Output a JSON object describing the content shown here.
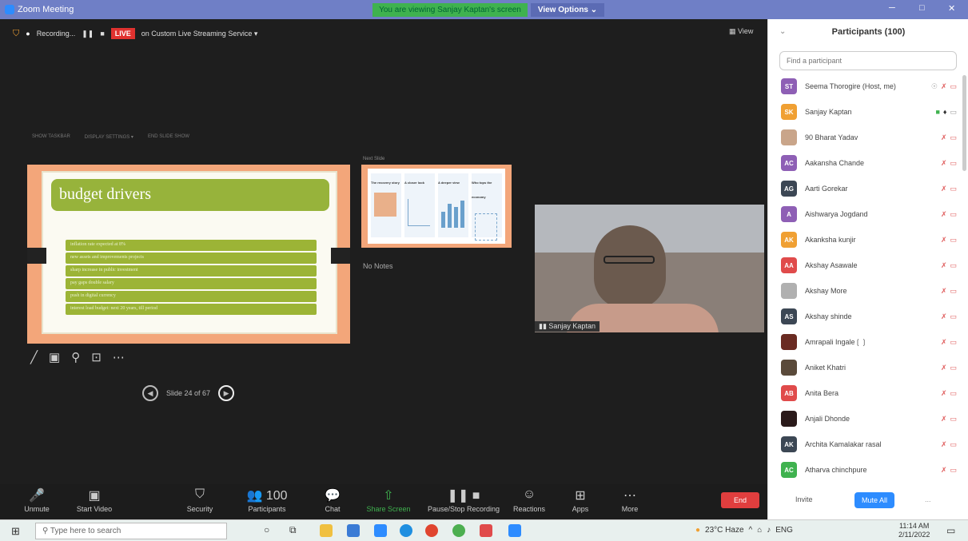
{
  "window": {
    "title": "Zoom Meeting",
    "viewing_banner": "You are viewing Sanjay Kaptan's screen",
    "view_options": "View Options ⌄",
    "minimize": "─",
    "maximize": "□",
    "close": "✕"
  },
  "recording": {
    "status": "Recording...",
    "pause": "❚❚",
    "stop": "■",
    "live_badge": "LIVE",
    "streaming_text": "on Custom Live Streaming Service ▾"
  },
  "view_button": "View",
  "presenter_toolbar": [
    "SHOW TASKBAR",
    "DISPLAY SETTINGS ▾",
    "END SLIDE SHOW"
  ],
  "slide": {
    "title": "budget drivers",
    "bullets": [
      "inflation rate expected at 8%",
      "new assets and improvements projects",
      "sharp increase in   public investment",
      "pay gaps double salary",
      "push in digital currency",
      "interest load budget: next 20 years, till period"
    ],
    "next_label": "Next Slide",
    "no_notes": "No Notes",
    "counter": "Slide 24 of 67"
  },
  "next_slide_cols": [
    "The recovery story",
    "A closer look",
    "A deeper view",
    "Who tops the economy"
  ],
  "video": {
    "name": "Sanjay Kaptan"
  },
  "annotation_tools": [
    "╱",
    "▣",
    "⚲",
    "⊡",
    "⋯"
  ],
  "toolbar": {
    "items": [
      {
        "icon": "🎤",
        "label": "Unmute"
      },
      {
        "icon": "▣",
        "label": "Start Video"
      },
      {
        "icon": "⛉",
        "label": "Security"
      },
      {
        "icon": "👥 100",
        "label": "Participants"
      },
      {
        "icon": "💬",
        "label": "Chat"
      },
      {
        "icon": "⇧",
        "label": "Share Screen"
      },
      {
        "icon": "❚❚ ■",
        "label": "Pause/Stop Recording"
      },
      {
        "icon": "☺",
        "label": "Reactions"
      },
      {
        "icon": "⊞",
        "label": "Apps"
      },
      {
        "icon": "⋯",
        "label": "More"
      }
    ],
    "end": "End"
  },
  "participants": {
    "title": "Participants (100)",
    "search_placeholder": "Find a participant",
    "list": [
      {
        "initials": "ST",
        "name": "Seema Thorogire (Host, me)",
        "color": "#8e5fb5"
      },
      {
        "initials": "SK",
        "name": "Sanjay Kaptan",
        "color": "#f0a033"
      },
      {
        "initials": "",
        "name": "90 Bharat Yadav",
        "color": "#c9a58a"
      },
      {
        "initials": "AC",
        "name": "Aakansha Chande",
        "color": "#8e5fb5"
      },
      {
        "initials": "AG",
        "name": "Aarti Gorekar",
        "color": "#3c4754"
      },
      {
        "initials": "A",
        "name": "Aishwarya Jogdand",
        "color": "#8e5fb5"
      },
      {
        "initials": "AK",
        "name": "Akanksha kunjir",
        "color": "#f0a033"
      },
      {
        "initials": "AA",
        "name": "Akshay Asawale",
        "color": "#e04b4b"
      },
      {
        "initials": "",
        "name": "Akshay More",
        "color": "#b0b0b0"
      },
      {
        "initials": "AS",
        "name": "Akshay shinde",
        "color": "#3c4754"
      },
      {
        "initials": "",
        "name": "Amrapali Ingale❲❳",
        "color": "#6a2b22"
      },
      {
        "initials": "",
        "name": "Aniket Khatri",
        "color": "#5a4a3a"
      },
      {
        "initials": "AB",
        "name": "Anita Bera",
        "color": "#e04b4b"
      },
      {
        "initials": "",
        "name": "Anjali Dhonde",
        "color": "#2a1a1a"
      },
      {
        "initials": "AK",
        "name": "Archita Kamalakar rasal",
        "color": "#3c4754"
      },
      {
        "initials": "AC",
        "name": "Atharva chinchpure",
        "color": "#3fb24f"
      }
    ],
    "invite": "Invite",
    "mute_all": "Mute All",
    "more": "..."
  },
  "taskbar": {
    "search": "Type here to search",
    "weather": "23°C Haze",
    "lang": "ENG",
    "time": "11:14 AM",
    "date": "2/11/2022"
  }
}
